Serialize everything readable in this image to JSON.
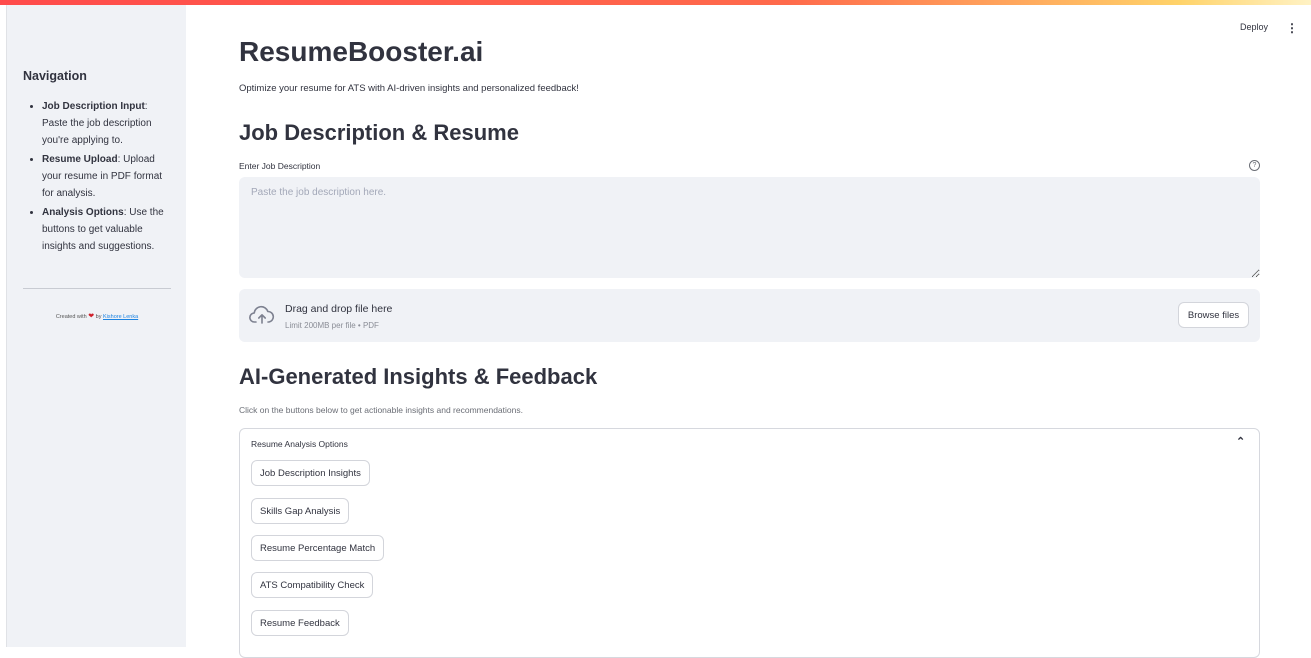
{
  "header": {
    "deploy_label": "Deploy",
    "menu_glyph": "⋮"
  },
  "sidebar": {
    "title": "Navigation",
    "items": [
      {
        "bold": "Job Description Input",
        "text": ": Paste the job description you're applying to."
      },
      {
        "bold": "Resume Upload",
        "text": ": Upload your resume in PDF format for analysis."
      },
      {
        "bold": "Analysis Options",
        "text": ": Use the buttons to get valuable insights and suggestions."
      }
    ],
    "credit": {
      "prefix": "Created with",
      "heart": "❤",
      "middle": "by",
      "author": "Kishore Lenka"
    }
  },
  "main": {
    "title": "ResumeBooster.ai",
    "subtitle": "Optimize your resume for ATS with AI-driven insights and personalized feedback!",
    "section1_heading": "Job Description & Resume",
    "jd_label": "Enter Job Description",
    "help_glyph": "?",
    "jd_placeholder": "Paste the job description here.",
    "jd_value": "",
    "uploader": {
      "title": "Drag and drop file here",
      "limit": "Limit 200MB per file • PDF",
      "browse_label": "Browse files",
      "icon": "cloud-upload-icon"
    },
    "section2_heading": "AI-Generated Insights & Feedback",
    "section2_sub": "Click on the buttons below to get actionable insights and recommendations.",
    "expander": {
      "label": "Resume Analysis Options",
      "chevron": "⌃",
      "expanded": true,
      "buttons": [
        "Job Description Insights",
        "Skills Gap Analysis",
        "Resume Percentage Match",
        "ATS Compatibility Check",
        "Resume Feedback"
      ]
    }
  },
  "colors": {
    "sidebar_bg": "#f0f2f6",
    "accent_red": "#ff4b4b",
    "link_blue": "#1c83e1",
    "text": "#31333f"
  }
}
